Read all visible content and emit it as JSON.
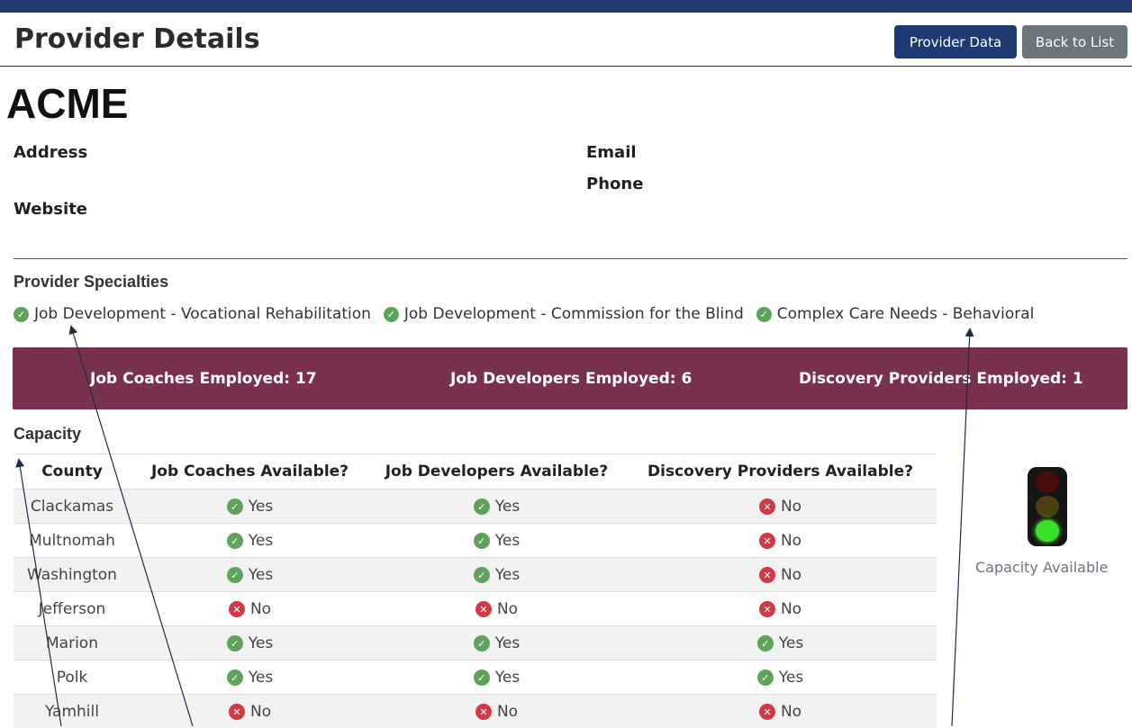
{
  "header": {
    "title": "Provider Details",
    "provider_data_label": "Provider Data",
    "back_label": "Back to List"
  },
  "provider": {
    "name": "ACME",
    "address_label": "Address",
    "website_label": "Website",
    "email_label": "Email",
    "phone_label": "Phone"
  },
  "specialties": {
    "heading": "Provider Specialties",
    "items": [
      "Job Development - Vocational Rehabilitation",
      "Job Development - Commission for the Blind",
      "Complex Care Needs - Behavioral"
    ]
  },
  "stats": {
    "job_coaches": "Job Coaches Employed: 17",
    "job_developers": "Job Developers Employed: 6",
    "discovery_providers": "Discovery Providers Employed: 1"
  },
  "capacity": {
    "heading": "Capacity",
    "columns": [
      "County",
      "Job Coaches Available?",
      "Job Developers Available?",
      "Discovery Providers Available?"
    ],
    "rows": [
      {
        "county": "Clackamas",
        "coach": "Yes",
        "dev": "Yes",
        "disc": "No"
      },
      {
        "county": "Multnomah",
        "coach": "Yes",
        "dev": "Yes",
        "disc": "No"
      },
      {
        "county": "Washington",
        "coach": "Yes",
        "dev": "Yes",
        "disc": "No"
      },
      {
        "county": "Jefferson",
        "coach": "No",
        "dev": "No",
        "disc": "No"
      },
      {
        "county": "Marion",
        "coach": "Yes",
        "dev": "Yes",
        "disc": "Yes"
      },
      {
        "county": "Polk",
        "coach": "Yes",
        "dev": "Yes",
        "disc": "Yes"
      },
      {
        "county": "Yamhill",
        "coach": "No",
        "dev": "No",
        "disc": "No"
      }
    ],
    "status_label": "Capacity Available",
    "status_light": "green"
  },
  "colors": {
    "yes": "#5fa35b",
    "no": "#cf3a45",
    "banner": "#7a3150",
    "primary": "#1d3a72"
  },
  "icons": {
    "yes": "check-circle-icon",
    "no": "x-circle-icon"
  }
}
